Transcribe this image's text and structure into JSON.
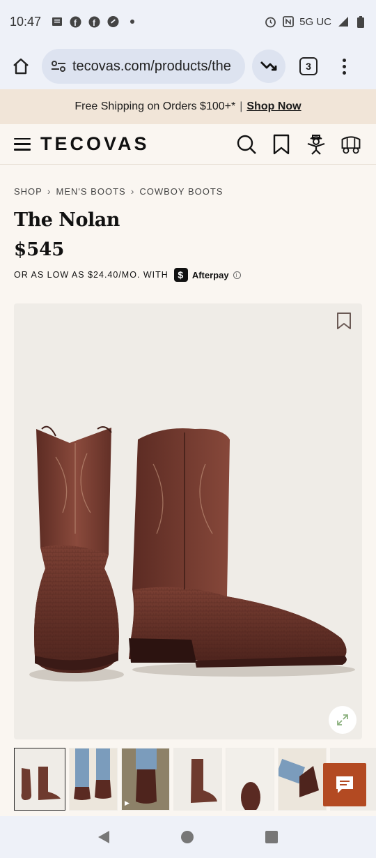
{
  "status_bar": {
    "time": "10:47",
    "network": "5G UC",
    "icons": [
      "message-icon",
      "facebook-icon",
      "facebook-icon",
      "link-icon",
      "dot-icon",
      "alarm-icon",
      "nfc-icon",
      "signal-icon",
      "battery-icon"
    ]
  },
  "browser": {
    "url": "tecovas.com/products/the",
    "tab_count": "3"
  },
  "promo": {
    "text": "Free Shipping on Orders $100+*",
    "separator": "|",
    "link": "Shop Now"
  },
  "header": {
    "logo": "TECOVAS"
  },
  "breadcrumb": {
    "items": [
      "SHOP",
      "MEN'S BOOTS",
      "COWBOY BOOTS"
    ]
  },
  "product": {
    "title": "The Nolan",
    "price": "$545",
    "afterpay_text": "OR AS LOW AS $24.40/MO. WITH",
    "afterpay_badge": "$",
    "afterpay_name": "Afterpay",
    "info_glyph": "i"
  },
  "thumbnails": {
    "count": 7,
    "active_index": 0
  },
  "colors": {
    "accent": "#b34a22",
    "promo_bg": "#f1e5d8",
    "page_bg": "#faf6f1",
    "boot_leather": "#6e3a2e"
  }
}
